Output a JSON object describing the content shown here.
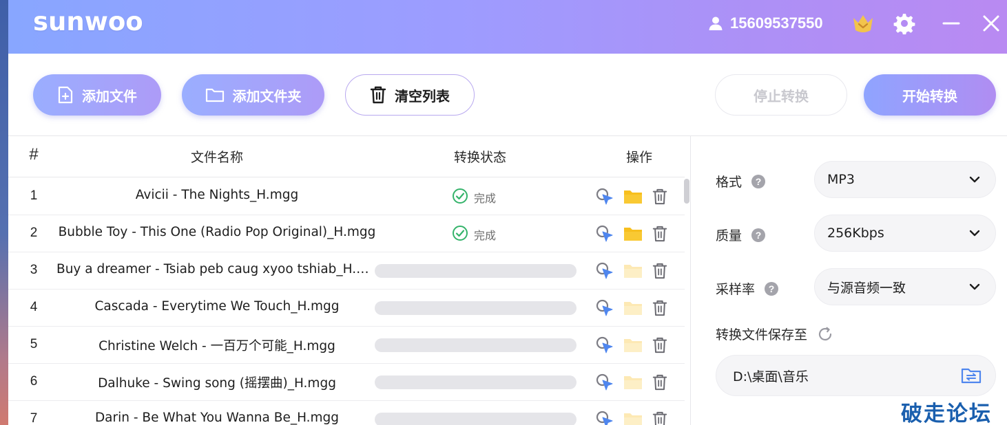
{
  "app": {
    "logo": "sunwoo"
  },
  "user": {
    "phone": "15609537550"
  },
  "toolbar": {
    "add_file": "添加文件",
    "add_folder": "添加文件夹",
    "clear_list": "清空列表",
    "stop": "停止转换",
    "start": "开始转换"
  },
  "table": {
    "headers": {
      "index": "#",
      "name": "文件名称",
      "status": "转换状态",
      "actions": "操作"
    },
    "rows": [
      {
        "index": "1",
        "name": "Avicii - The Nights_H.mgg",
        "status": "完成"
      },
      {
        "index": "2",
        "name": "Bubble Toy - This One (Radio Pop Original)_H.mgg",
        "status": "完成"
      },
      {
        "index": "3",
        "name": "Buy a dreamer - Tsiab peb caug xyoo tshiab_H.mgg",
        "status": ""
      },
      {
        "index": "4",
        "name": "Cascada - Everytime We Touch_H.mgg",
        "status": ""
      },
      {
        "index": "5",
        "name": "Christine Welch - 一百万个可能_H.mgg",
        "status": ""
      },
      {
        "index": "6",
        "name": "Dalhuke - Swing song (摇摆曲)_H.mgg",
        "status": ""
      },
      {
        "index": "7",
        "name": "Darin - Be What You Wanna Be_H.mgg",
        "status": ""
      }
    ]
  },
  "settings": {
    "format_label": "格式",
    "format_value": "MP3",
    "quality_label": "质量",
    "quality_value": "256Kbps",
    "samplerate_label": "采样率",
    "samplerate_value": "与源音频一致",
    "save_label": "转换文件保存至",
    "save_path": "D:\\桌面\\音乐",
    "help_glyph": "?"
  },
  "watermark": "破走论坛",
  "colors": {
    "accent": "#9aa8ff",
    "done_green": "#34b36a",
    "folder_yellow": "#f7bf1e",
    "link_blue": "#4f86ee"
  }
}
